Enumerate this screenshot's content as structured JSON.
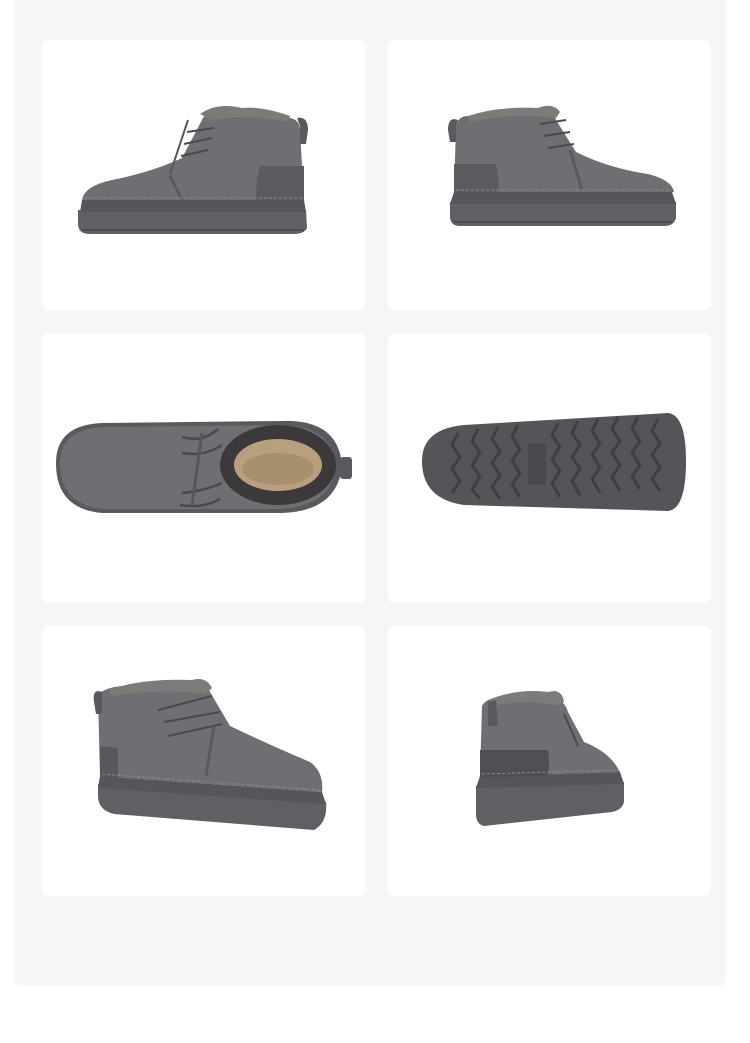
{
  "gallery": {
    "background": "#f6f6f6",
    "card_background": "#ffffff",
    "product_color": "#6e6e72",
    "sole_color": "#5f5f63",
    "lining_color": "#3a3536",
    "insole_color": "#b49a7a",
    "views": [
      {
        "name": "side-profile-left"
      },
      {
        "name": "side-profile-right"
      },
      {
        "name": "top-view"
      },
      {
        "name": "outsole-bottom-view"
      },
      {
        "name": "three-quarter-front-view"
      },
      {
        "name": "rear-three-quarter-view"
      }
    ]
  }
}
